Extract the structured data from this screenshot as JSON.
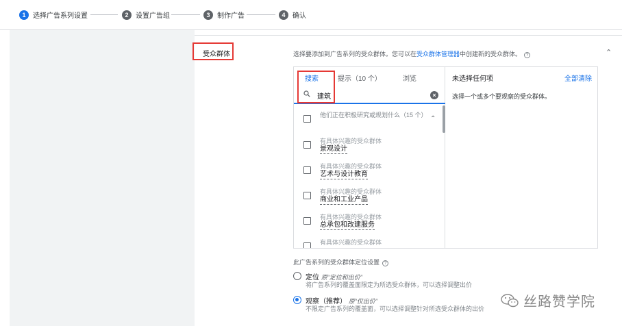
{
  "stepper": {
    "steps": [
      {
        "num": "1",
        "label": "选择广告系列设置"
      },
      {
        "num": "2",
        "label": "设置广告组"
      },
      {
        "num": "3",
        "label": "制作广告"
      },
      {
        "num": "4",
        "label": "确认"
      }
    ]
  },
  "section": {
    "title": "受众群体",
    "description_prefix": "选择要添加到广告系列的受众群体。您可以在",
    "description_link": "受众群体管理器",
    "description_suffix": "中创建新的受众群体。",
    "help_icon": "?"
  },
  "picker": {
    "tabs": [
      {
        "label": "搜索"
      },
      {
        "label": "提示（10 个）"
      },
      {
        "label": "浏览"
      }
    ],
    "search": {
      "value": "建筑"
    },
    "group": {
      "label": "他们正在积极研究或规划什么（15 个）"
    },
    "items": [
      {
        "sub": "有具体兴趣的受众群体",
        "main": "景观设计"
      },
      {
        "sub": "有具体兴趣的受众群体",
        "main": "艺术与设计教育"
      },
      {
        "sub": "有具体兴趣的受众群体",
        "main": "商业和工业产品"
      },
      {
        "sub": "有具体兴趣的受众群体",
        "main": "总承包和改建服务"
      },
      {
        "sub": "有具体兴趣的受众群体",
        "main": ""
      }
    ],
    "right": {
      "header": "未选择任何项",
      "clear_all": "全部清除",
      "hint": "选择一个或多个要观察的受众群体。"
    }
  },
  "targeting": {
    "title": "此广告系列的受众群体定位设置",
    "options": [
      {
        "name": "定位",
        "alias": "原“定位和出价”",
        "desc": "将广告系列的覆盖面限定为所选受众群体，可以选择调整出价",
        "checked": false
      },
      {
        "name": "观察（推荐）",
        "alias": "原“仅出价”",
        "desc": "不限定广告系列的覆盖面，可以选择调整针对所选受众群体的出价",
        "checked": true
      }
    ]
  },
  "watermark": {
    "text": "丝路赞学院"
  },
  "colors": {
    "accent": "#1a73e8",
    "highlight_box": "#e53935"
  }
}
